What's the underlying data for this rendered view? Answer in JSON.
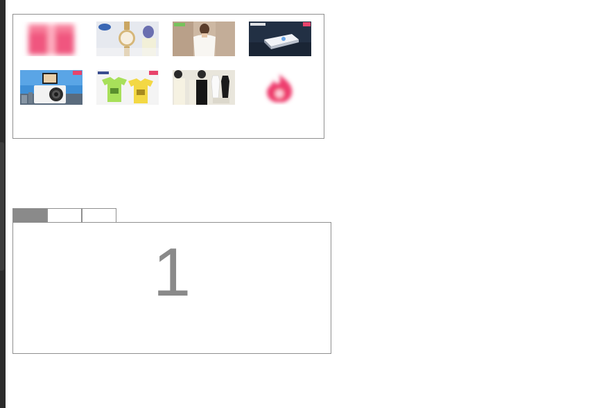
{
  "products": {
    "items": [
      {
        "name": "red-gift-promo-image"
      },
      {
        "name": "disney-gold-watch-promo-image"
      },
      {
        "name": "white-blouse-model-image"
      },
      {
        "name": "projector-promo-image"
      },
      {
        "name": "digital-camera-promo-image"
      },
      {
        "name": "kids-tshirts-promo-image"
      },
      {
        "name": "camisoles-promo-image"
      },
      {
        "name": "red-flame-promo-image"
      }
    ]
  },
  "tabs": {
    "items": [
      {
        "label": "",
        "active": true
      },
      {
        "label": "",
        "active": false
      },
      {
        "label": "",
        "active": false
      }
    ],
    "content": {
      "number": "1"
    }
  },
  "colors": {
    "border": "#8f8f8f",
    "tab_active": "#8a8a8a",
    "number": "#8a8a8a",
    "rail": "#2b2b2b"
  }
}
